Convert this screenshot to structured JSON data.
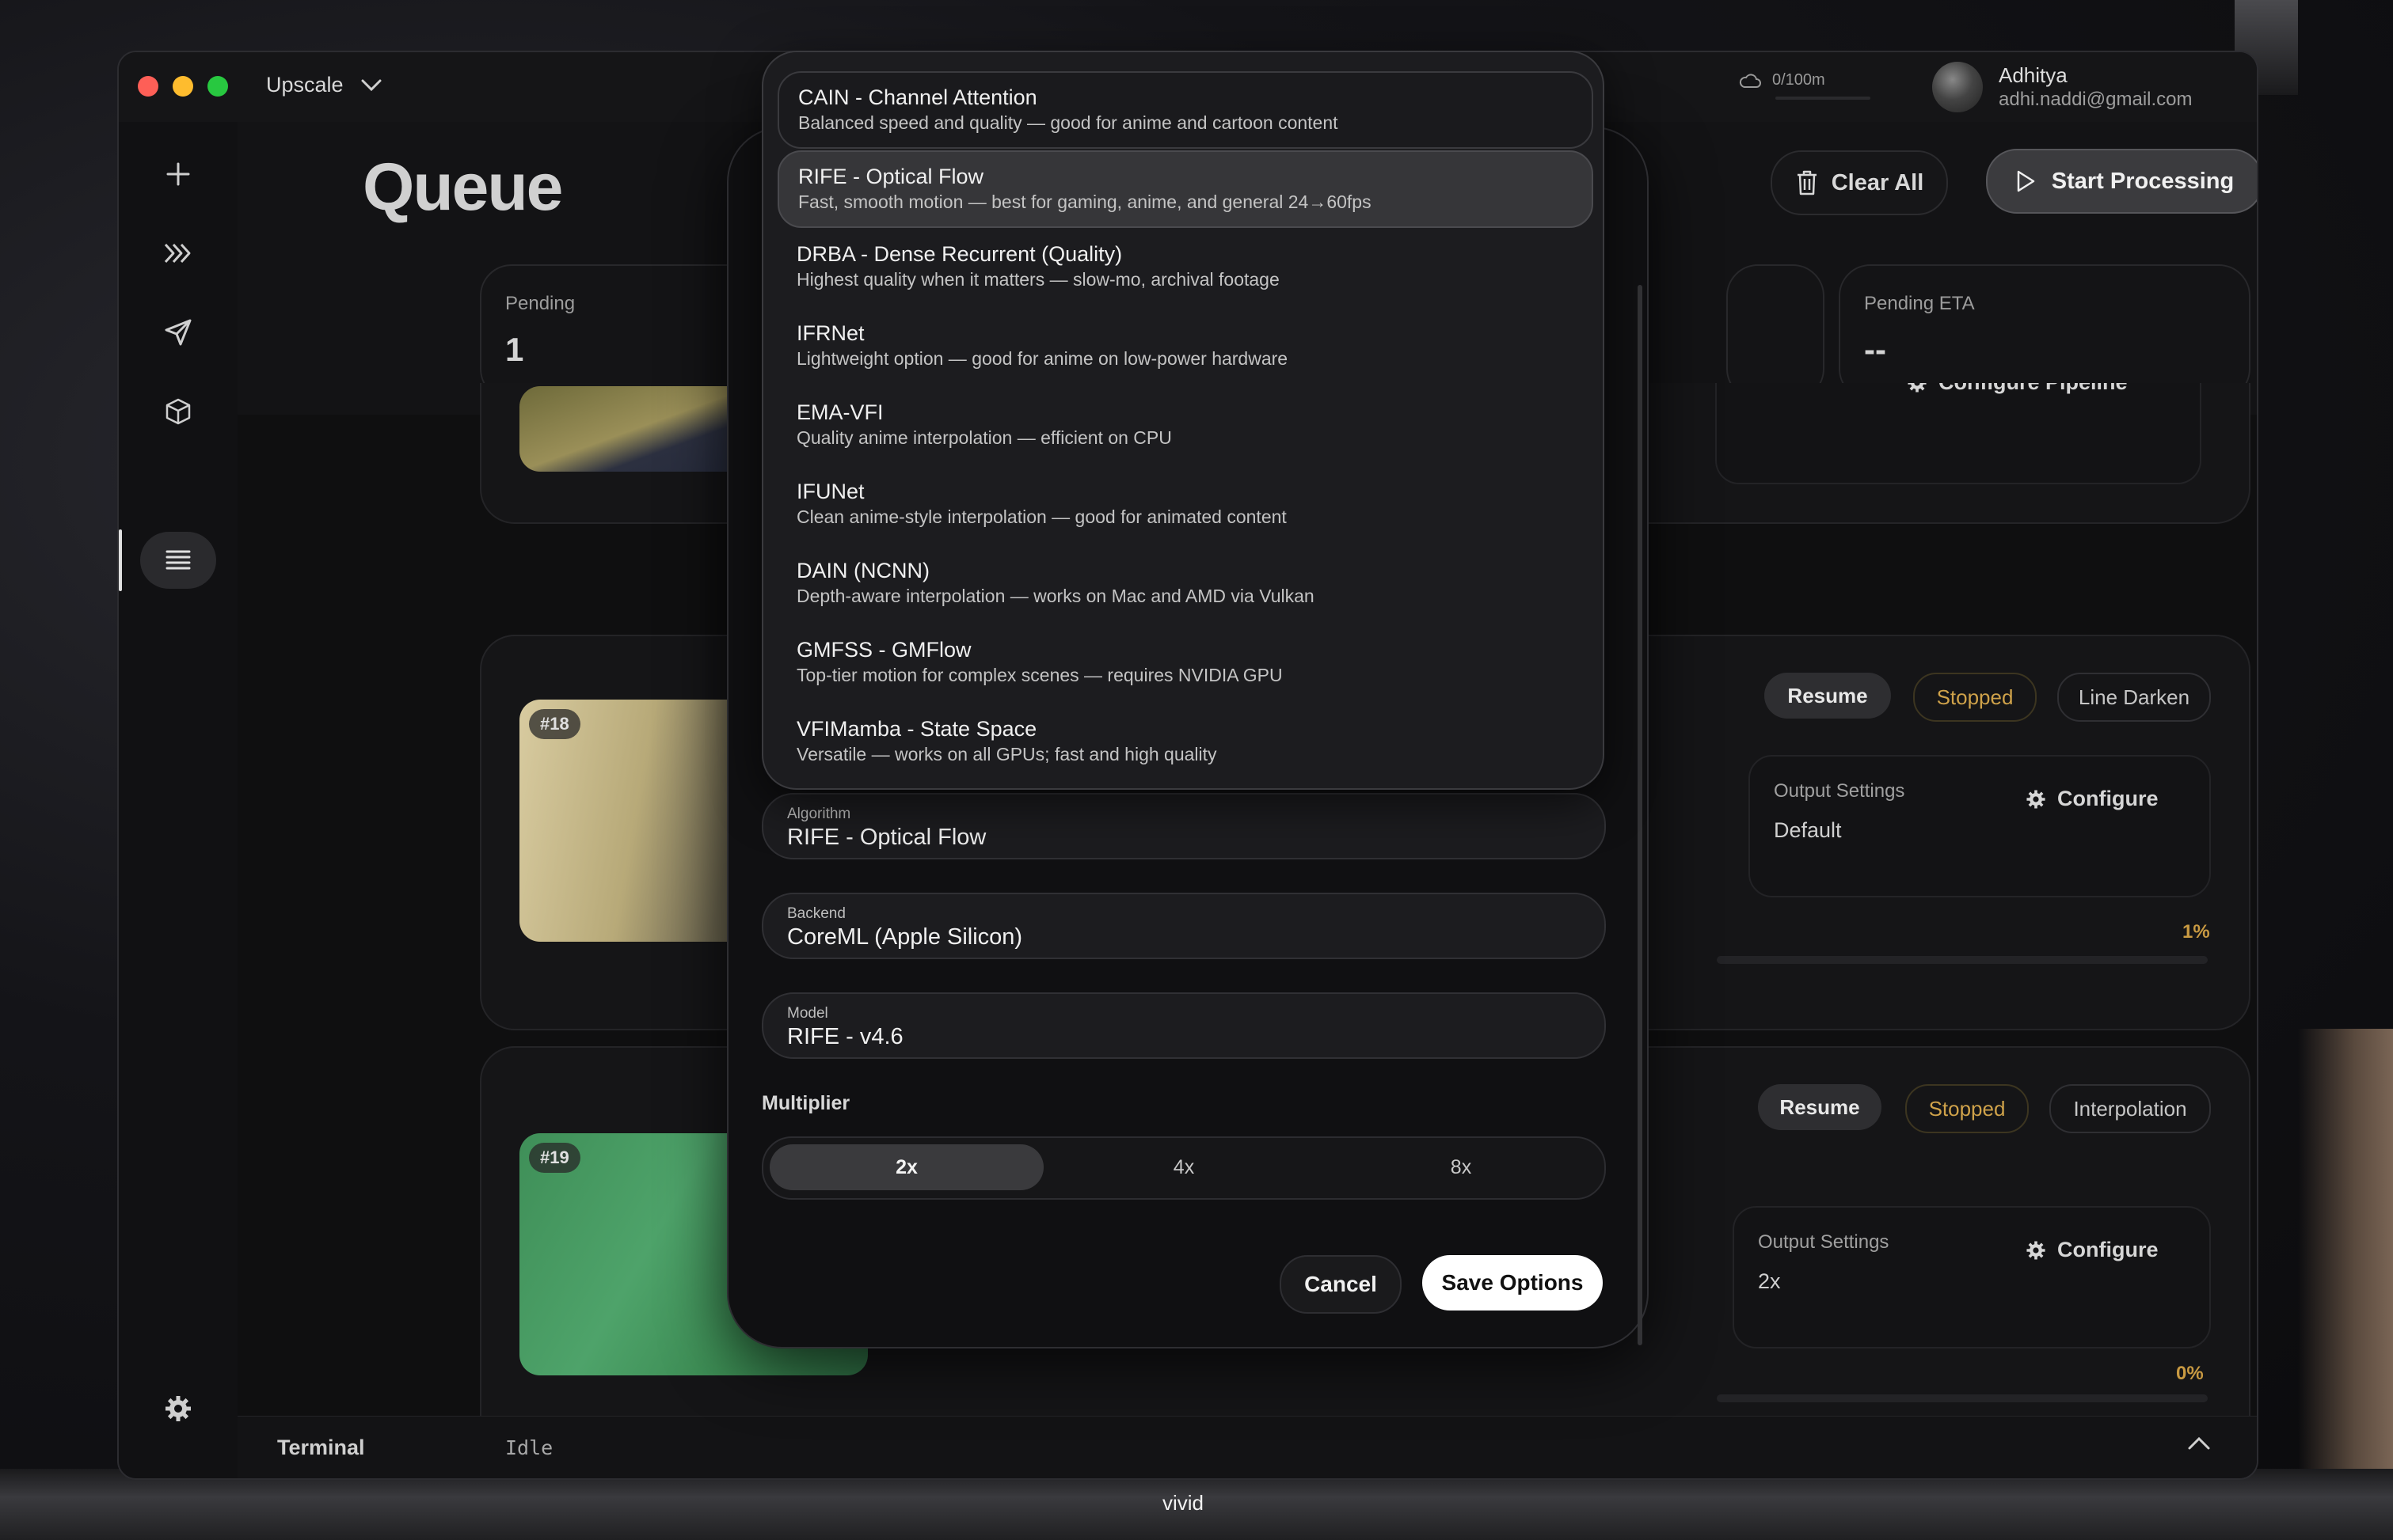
{
  "window": {
    "app_select": "Upscale"
  },
  "account": {
    "cloud_usage": "0/100m",
    "name": "Adhitya",
    "email": "adhi.naddi@gmail.com"
  },
  "page": {
    "title": "Queue"
  },
  "toolbar": {
    "clear_all": "Clear All",
    "start_processing": "Start Processing"
  },
  "stats": [
    {
      "label": "Pending",
      "value": "1"
    },
    {
      "label": "Pending ETA",
      "value": "--"
    }
  ],
  "jobs": [
    {
      "configure_pipeline": "Configure Pipeline"
    },
    {
      "badge": "#18",
      "resume": "Resume",
      "status": "Stopped",
      "tag": "Line Darken",
      "output_label": "Output Settings",
      "output_value": "Default",
      "configure": "Configure",
      "progress_text": "1%",
      "progress": 0.01
    },
    {
      "badge": "#19",
      "resume": "Resume",
      "status": "Stopped",
      "tag": "Interpolation",
      "output_label": "Output Settings",
      "output_value": "2x",
      "configure": "Configure",
      "progress_text": "0%",
      "progress": 0.0
    }
  ],
  "terminal": {
    "label": "Terminal",
    "status": "Idle"
  },
  "desktop": {
    "caption": "vivid"
  },
  "modal": {
    "algorithm_options": [
      {
        "title": "CAIN - Channel Attention",
        "desc": "Balanced speed and quality — good for anime and cartoon content"
      },
      {
        "title": "RIFE - Optical Flow",
        "desc": "Fast, smooth motion — best for gaming, anime, and general 24→60fps"
      },
      {
        "title": "DRBA - Dense Recurrent (Quality)",
        "desc": "Highest quality when it matters — slow-mo, archival footage"
      },
      {
        "title": "IFRNet",
        "desc": "Lightweight option — good for anime on low-power hardware"
      },
      {
        "title": "EMA-VFI",
        "desc": "Quality anime interpolation — efficient on CPU"
      },
      {
        "title": "IFUNet",
        "desc": "Clean anime-style interpolation — good for animated content"
      },
      {
        "title": "DAIN (NCNN)",
        "desc": "Depth-aware interpolation — works on Mac and AMD via Vulkan"
      },
      {
        "title": "GMFSS - GMFlow",
        "desc": "Top-tier motion for complex scenes — requires NVIDIA GPU"
      },
      {
        "title": "VFIMamba - State Space",
        "desc": "Versatile — works on all GPUs; fast and high quality"
      }
    ],
    "selected_option": "RIFE - Optical Flow",
    "algorithm": {
      "label": "Algorithm",
      "value": "RIFE - Optical Flow"
    },
    "backend": {
      "label": "Backend",
      "value": "CoreML (Apple Silicon)"
    },
    "model": {
      "label": "Model",
      "value": "RIFE - v4.6"
    },
    "multiplier": {
      "label": "Multiplier",
      "options": [
        "2x",
        "4x",
        "8x"
      ],
      "selected": "2x"
    },
    "cancel": "Cancel",
    "save": "Save Options"
  },
  "colors": {
    "accent_status": "#cfa24a",
    "primary_button": "#ffffff",
    "window_bg": "#111113"
  },
  "icons": {
    "sidebar": [
      "plus-icon",
      "frames-icon",
      "send-icon",
      "cube-icon",
      "queue-list-icon",
      "gear-icon"
    ],
    "toolbar": [
      "trash-icon",
      "play-icon"
    ],
    "misc": [
      "chevron-down-icon",
      "cloud-icon",
      "chevron-up-icon"
    ]
  }
}
